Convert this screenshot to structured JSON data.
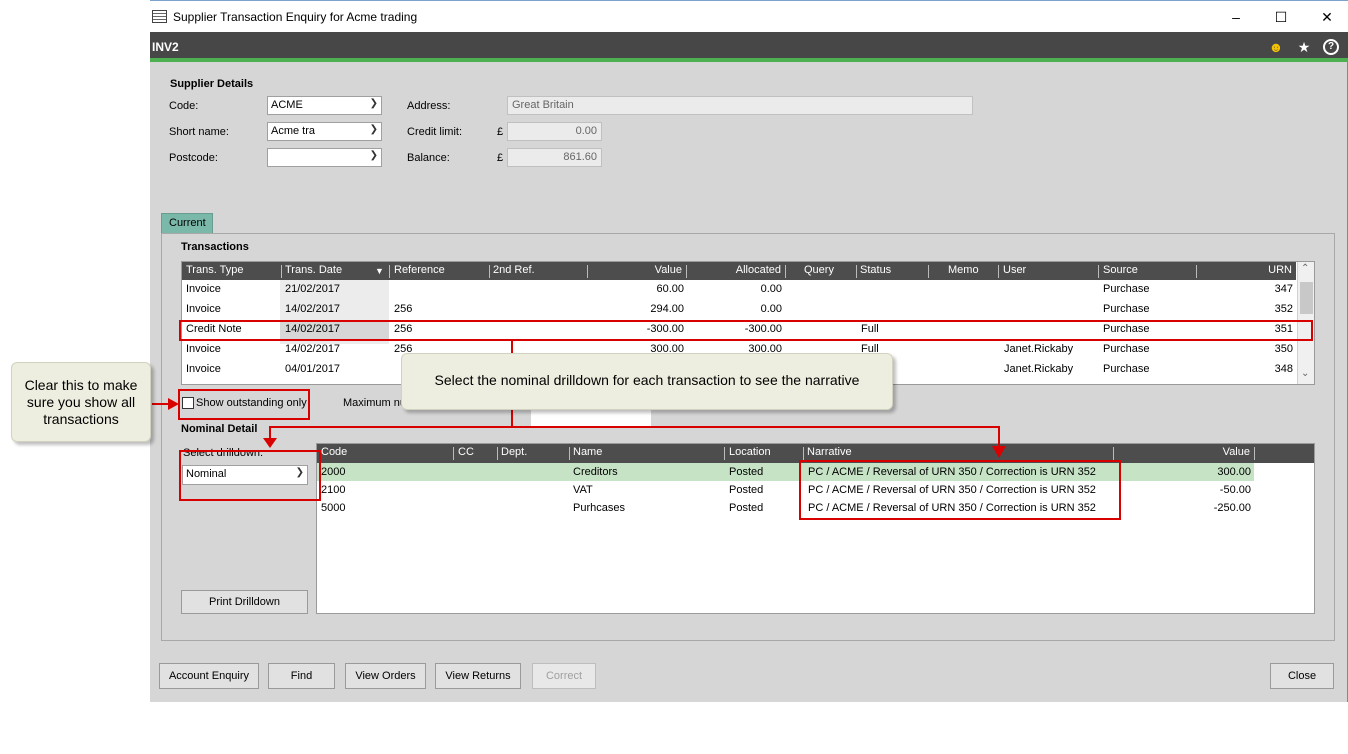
{
  "window": {
    "title": "Supplier Transaction Enquiry for Acme trading",
    "controls": [
      "–",
      "☐",
      "✕"
    ]
  },
  "header_bar": {
    "code": "INV2",
    "icons": [
      "smiley-icon",
      "star-icon",
      "help-icon"
    ]
  },
  "supplier_details": {
    "title": "Supplier Details",
    "code_label": "Code:",
    "code_value": "ACME",
    "short_name_label": "Short name:",
    "short_name_value": "Acme tra",
    "postcode_label": "Postcode:",
    "postcode_value": "",
    "address_label": "Address:",
    "address_value": "Great Britain",
    "credit_limit_label": "Credit limit:",
    "currency_symbol": "£",
    "credit_limit_value": "0.00",
    "balance_label": "Balance:",
    "balance_value": "861.60"
  },
  "tabs": [
    {
      "label": "Current"
    }
  ],
  "transactions": {
    "title": "Transactions",
    "columns": [
      "Trans. Type",
      "Trans. Date",
      "Reference",
      "2nd Ref.",
      "Value",
      "Allocated",
      "Query",
      "Status",
      "Memo",
      "User",
      "Source",
      "URN"
    ],
    "rows": [
      {
        "type": "Invoice",
        "date": "21/02/2017",
        "reference": "",
        "second_ref": "",
        "value": "60.00",
        "allocated": "0.00",
        "query": "",
        "status": "",
        "memo": "",
        "user": "",
        "source": "Purchase",
        "urn": "347"
      },
      {
        "type": "Invoice",
        "date": "14/02/2017",
        "reference": "256",
        "second_ref": "",
        "value": "294.00",
        "allocated": "0.00",
        "query": "",
        "status": "",
        "memo": "",
        "user": "",
        "source": "Purchase",
        "urn": "352"
      },
      {
        "type": "Credit Note",
        "date": "14/02/2017",
        "reference": "256",
        "second_ref": "",
        "value": "-300.00",
        "allocated": "-300.00",
        "query": "",
        "status": "Full",
        "memo": "",
        "user": "",
        "source": "Purchase",
        "urn": "351"
      },
      {
        "type": "Invoice",
        "date": "14/02/2017",
        "reference": "256",
        "second_ref": "",
        "value": "300.00",
        "allocated": "300.00",
        "query": "",
        "status": "Full",
        "memo": "",
        "user": "Janet.Rickaby",
        "source": "Purchase",
        "urn": "350"
      },
      {
        "type": "Invoice",
        "date": "04/01/2017",
        "reference": "",
        "second_ref": "",
        "value": "",
        "allocated": "",
        "query": "",
        "status": "",
        "memo": "",
        "user": "Janet.Rickaby",
        "source": "Purchase",
        "urn": "348"
      }
    ],
    "show_outstanding_label": "Show outstanding only",
    "show_outstanding_checked": false,
    "maximum_label": "Maximum nu"
  },
  "nominal_detail": {
    "title": "Nominal Detail",
    "select_label": "Select drilldown:",
    "select_value": "Nominal",
    "columns": [
      "Code",
      "CC",
      "Dept.",
      "Name",
      "Location",
      "Narrative",
      "Value"
    ],
    "rows": [
      {
        "code": "2000",
        "cc": "",
        "dept": "",
        "name": "Creditors",
        "location": "Posted",
        "narrative": "PC / ACME / Reversal of URN 350 / Correction is URN 352",
        "value": "300.00"
      },
      {
        "code": "2100",
        "cc": "",
        "dept": "",
        "name": "VAT",
        "location": "Posted",
        "narrative": "PC / ACME / Reversal of URN 350 / Correction is URN 352",
        "value": "-50.00"
      },
      {
        "code": "5000",
        "cc": "",
        "dept": "",
        "name": "Purhcases",
        "location": "Posted",
        "narrative": "PC / ACME / Reversal of URN 350 / Correction is URN 352",
        "value": "-250.00"
      }
    ],
    "print_button": "Print Drilldown"
  },
  "footer_buttons": {
    "account_enquiry": "Account Enquiry",
    "find": "Find",
    "view_orders": "View Orders",
    "view_returns": "View Returns",
    "correct": "Correct",
    "close": "Close"
  },
  "callouts": {
    "left": "Clear this to make sure you show all transactions",
    "center": "Select the nominal drilldown for each transaction to see the narrative"
  },
  "colors": {
    "accent_green": "#4caf50",
    "selected_row": "#c6e3c6",
    "annotation_red": "#d90000",
    "tab": "#7ab8a9"
  }
}
